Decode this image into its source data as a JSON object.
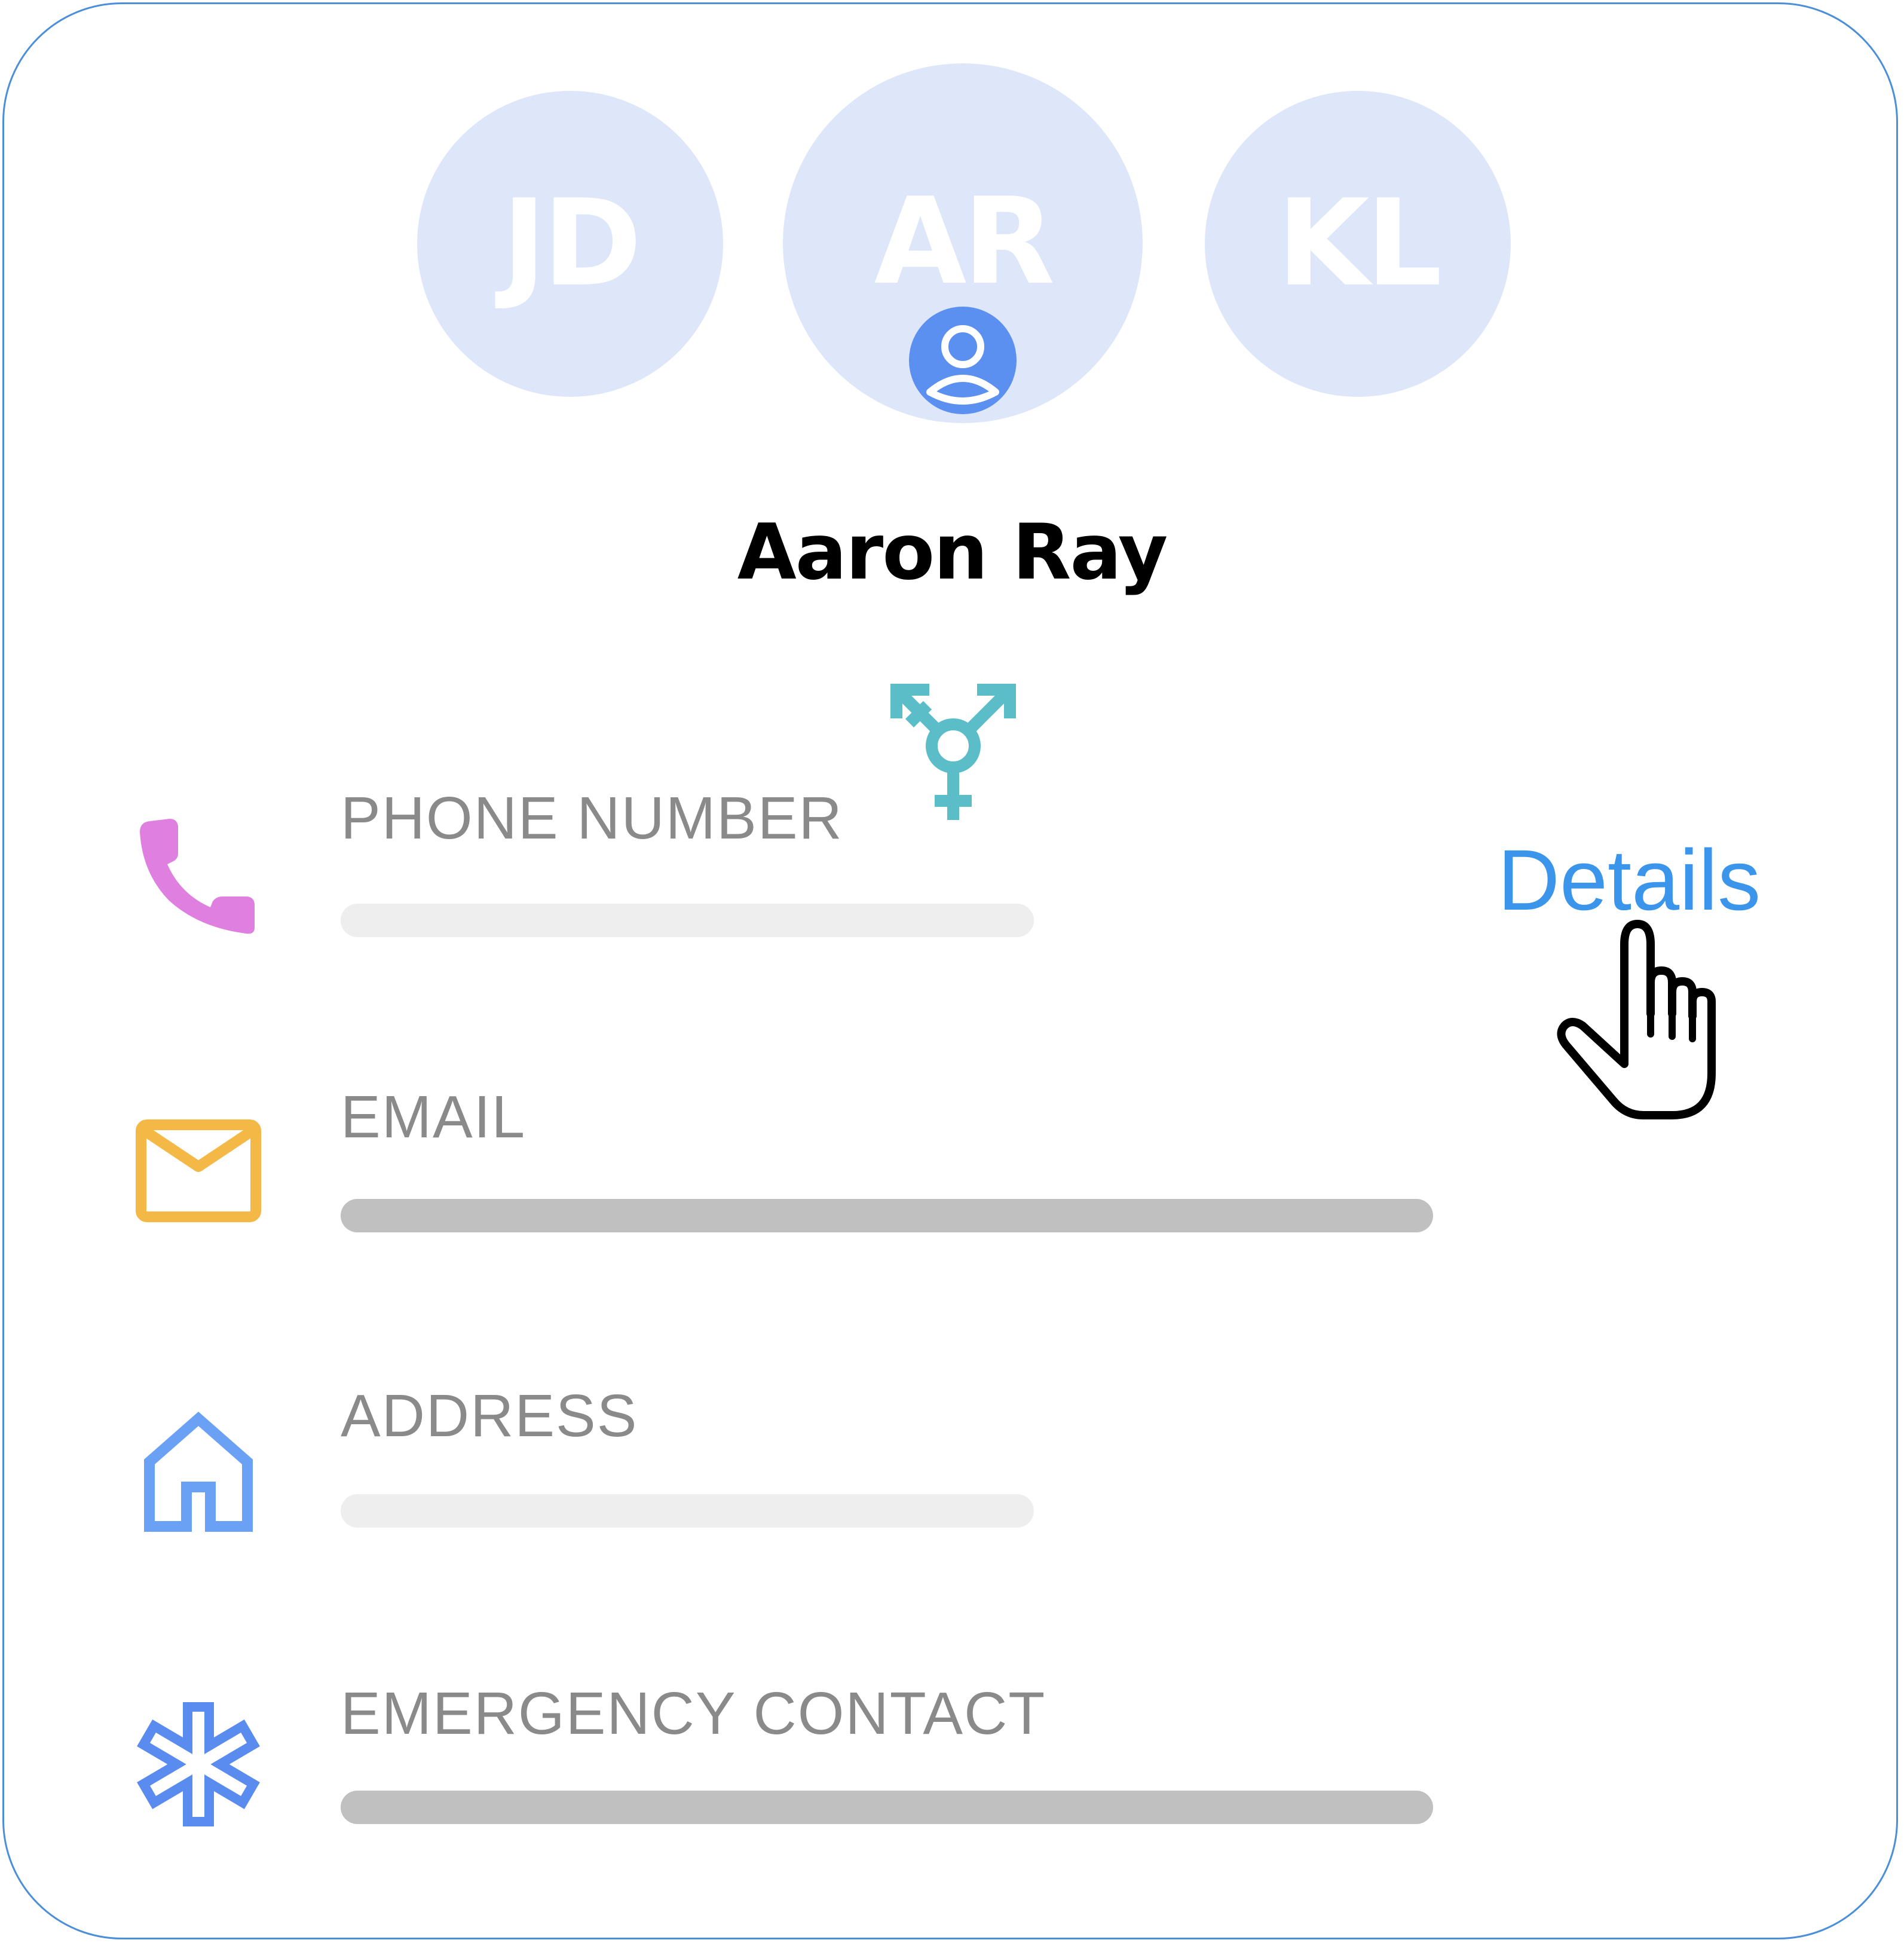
{
  "avatars": [
    {
      "initials": "JD"
    },
    {
      "initials": "AR",
      "selected": true
    },
    {
      "initials": "KL"
    }
  ],
  "profile": {
    "name": "Aaron Ray",
    "gender_icon": "transgender-symbol-icon",
    "badge_icon": "user-account-icon"
  },
  "fields": [
    {
      "label": "PHONE NUMBER",
      "icon": "phone-icon",
      "icon_color": "#df7fe0"
    },
    {
      "label": "EMAIL",
      "icon": "mail-icon",
      "icon_color": "#f3b845"
    },
    {
      "label": "ADDRESS",
      "icon": "home-icon",
      "icon_color": "#6aa1f5"
    },
    {
      "label": "EMERGENCY CONTACT",
      "icon": "medical-star-icon",
      "icon_color": "#5a8cef"
    }
  ],
  "actions": {
    "details_label": "Details",
    "cursor_icon": "hand-pointer-icon"
  },
  "colors": {
    "border": "#4a8fd8",
    "avatar_bg": "#dde7f9",
    "link": "#3b95ea",
    "gender_icon": "#5bbdc8",
    "badge": "#5b8ff0"
  }
}
